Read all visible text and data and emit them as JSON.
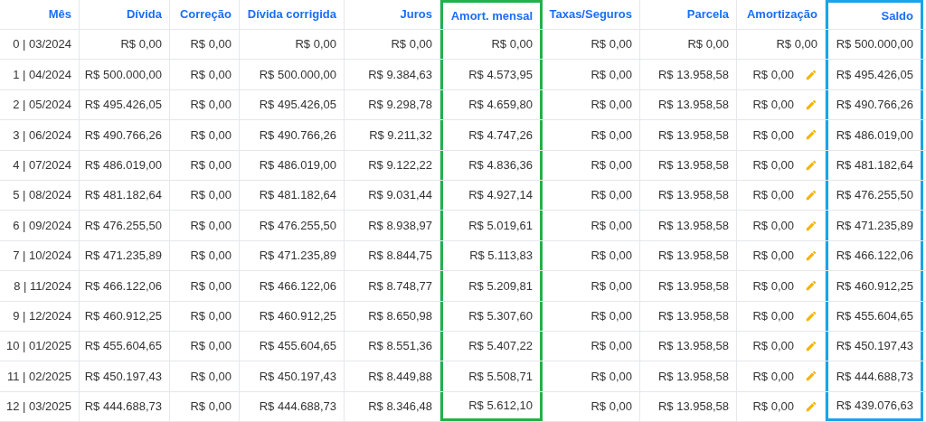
{
  "table": {
    "columns": [
      {
        "label": "Mês"
      },
      {
        "label": "Dívida"
      },
      {
        "label": "Correção"
      },
      {
        "label": "Dívida corrigida"
      },
      {
        "label": "Juros"
      },
      {
        "label": "Amort. mensal",
        "color": "#22b14c"
      },
      {
        "label": "Taxas/Seguros"
      },
      {
        "label": "Parcela"
      },
      {
        "label": "Amortização"
      },
      {
        "label": "Saldo",
        "color": "#1aa3e8"
      }
    ],
    "rows": [
      {
        "editable": false,
        "cells": [
          "0 | 03/2024",
          "R$ 0,00",
          "R$ 0,00",
          "R$ 0,00",
          "R$ 0,00",
          "R$ 0,00",
          "R$ 0,00",
          "R$ 0,00",
          "R$ 0,00",
          "R$ 500.000,00"
        ]
      },
      {
        "editable": true,
        "cells": [
          "1 | 04/2024",
          "R$ 500.000,00",
          "R$ 0,00",
          "R$ 500.000,00",
          "R$ 9.384,63",
          "R$ 4.573,95",
          "R$ 0,00",
          "R$ 13.958,58",
          "R$ 0,00",
          "R$ 495.426,05"
        ]
      },
      {
        "editable": true,
        "cells": [
          "2 | 05/2024",
          "R$ 495.426,05",
          "R$ 0,00",
          "R$ 495.426,05",
          "R$ 9.298,78",
          "R$ 4.659,80",
          "R$ 0,00",
          "R$ 13.958,58",
          "R$ 0,00",
          "R$ 490.766,26"
        ]
      },
      {
        "editable": true,
        "cells": [
          "3 | 06/2024",
          "R$ 490.766,26",
          "R$ 0,00",
          "R$ 490.766,26",
          "R$ 9.211,32",
          "R$ 4.747,26",
          "R$ 0,00",
          "R$ 13.958,58",
          "R$ 0,00",
          "R$ 486.019,00"
        ]
      },
      {
        "editable": true,
        "cells": [
          "4 | 07/2024",
          "R$ 486.019,00",
          "R$ 0,00",
          "R$ 486.019,00",
          "R$ 9.122,22",
          "R$ 4.836,36",
          "R$ 0,00",
          "R$ 13.958,58",
          "R$ 0,00",
          "R$ 481.182,64"
        ]
      },
      {
        "editable": true,
        "cells": [
          "5 | 08/2024",
          "R$ 481.182,64",
          "R$ 0,00",
          "R$ 481.182,64",
          "R$ 9.031,44",
          "R$ 4.927,14",
          "R$ 0,00",
          "R$ 13.958,58",
          "R$ 0,00",
          "R$ 476.255,50"
        ]
      },
      {
        "editable": true,
        "cells": [
          "6 | 09/2024",
          "R$ 476.255,50",
          "R$ 0,00",
          "R$ 476.255,50",
          "R$ 8.938,97",
          "R$ 5.019,61",
          "R$ 0,00",
          "R$ 13.958,58",
          "R$ 0,00",
          "R$ 471.235,89"
        ]
      },
      {
        "editable": true,
        "cells": [
          "7 | 10/2024",
          "R$ 471.235,89",
          "R$ 0,00",
          "R$ 471.235,89",
          "R$ 8.844,75",
          "R$ 5.113,83",
          "R$ 0,00",
          "R$ 13.958,58",
          "R$ 0,00",
          "R$ 466.122,06"
        ]
      },
      {
        "editable": true,
        "cells": [
          "8 | 11/2024",
          "R$ 466.122,06",
          "R$ 0,00",
          "R$ 466.122,06",
          "R$ 8.748,77",
          "R$ 5.209,81",
          "R$ 0,00",
          "R$ 13.958,58",
          "R$ 0,00",
          "R$ 460.912,25"
        ]
      },
      {
        "editable": true,
        "cells": [
          "9 | 12/2024",
          "R$ 460.912,25",
          "R$ 0,00",
          "R$ 460.912,25",
          "R$ 8.650,98",
          "R$ 5.307,60",
          "R$ 0,00",
          "R$ 13.958,58",
          "R$ 0,00",
          "R$ 455.604,65"
        ]
      },
      {
        "editable": true,
        "cells": [
          "10 | 01/2025",
          "R$ 455.604,65",
          "R$ 0,00",
          "R$ 455.604,65",
          "R$ 8.551,36",
          "R$ 5.407,22",
          "R$ 0,00",
          "R$ 13.958,58",
          "R$ 0,00",
          "R$ 450.197,43"
        ]
      },
      {
        "editable": true,
        "cells": [
          "11 | 02/2025",
          "R$ 450.197,43",
          "R$ 0,00",
          "R$ 450.197,43",
          "R$ 8.449,88",
          "R$ 5.508,71",
          "R$ 0,00",
          "R$ 13.958,58",
          "R$ 0,00",
          "R$ 444.688,73"
        ]
      },
      {
        "editable": true,
        "cells": [
          "12 | 03/2025",
          "R$ 444.688,73",
          "R$ 0,00",
          "R$ 444.688,73",
          "R$ 8.346,48",
          "R$ 5.612,10",
          "R$ 0,00",
          "R$ 13.958,58",
          "R$ 0,00",
          "R$ 439.076,63"
        ]
      }
    ]
  }
}
